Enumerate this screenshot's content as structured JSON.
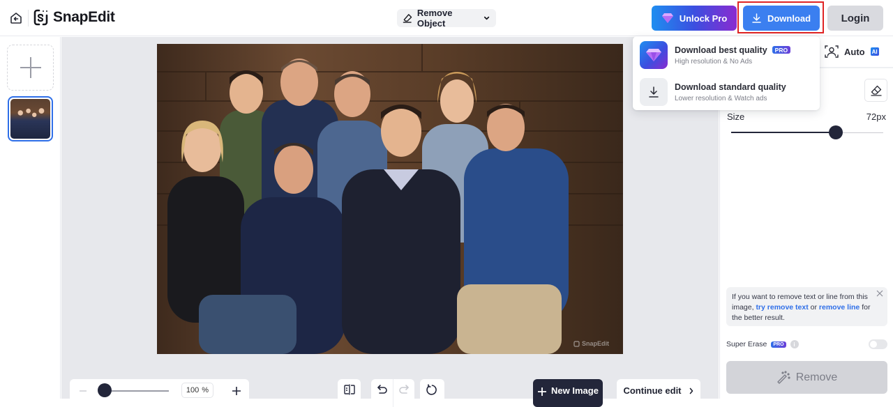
{
  "header": {
    "app_name": "SnapEdit",
    "tool_select": "Remove Object",
    "unlock_label": "Unlock Pro",
    "download_label": "Download",
    "login_label": "Login"
  },
  "download_menu": {
    "items": [
      {
        "title": "Download best quality",
        "badge": "PRO",
        "subtitle": "High resolution & No Ads"
      },
      {
        "title": "Download standard quality",
        "subtitle": "Lower resolution & Watch ads"
      }
    ]
  },
  "canvas": {
    "watermark": "SnapEdit",
    "zoom_value": "100",
    "zoom_unit": "%",
    "new_image_label": "New Image",
    "continue_label": "Continue edit"
  },
  "panel": {
    "auto_label": "Auto",
    "ai_badge": "AI",
    "size_label": "Size",
    "size_value": "72px",
    "size_fraction": 0.69,
    "tip": {
      "prefix": "If you want to remove text or line from this image, ",
      "link1": "try remove text",
      "middle": " or ",
      "link2": "remove line",
      "suffix": " for the better result."
    },
    "super_erase_label": "Super Erase",
    "super_erase_badge": "PRO",
    "super_erase_enabled": false,
    "remove_label": "Remove"
  },
  "colors": {
    "accent_blue": "#3b7ff0",
    "dark": "#23263a",
    "highlight_outline": "#e02424"
  }
}
